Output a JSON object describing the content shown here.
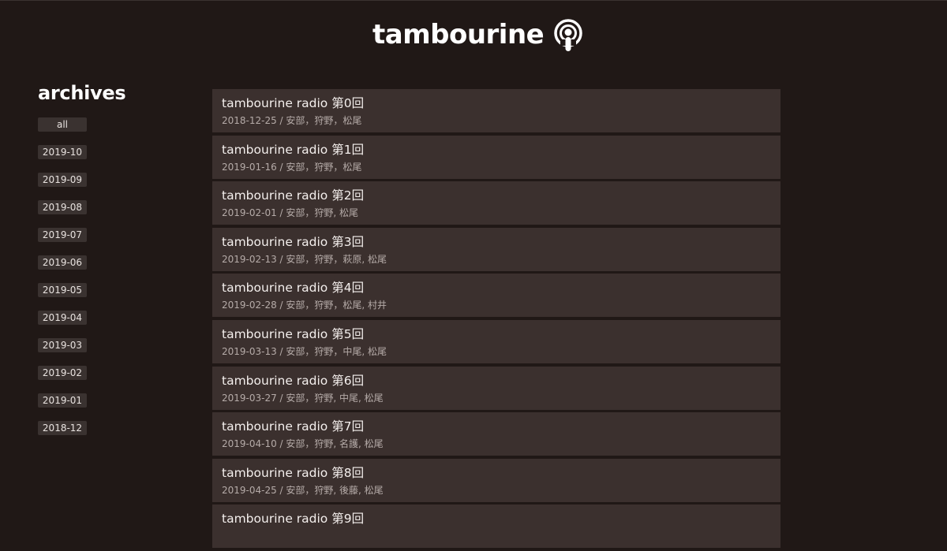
{
  "header": {
    "logo_text": "tambourine",
    "podcast_icon": "podcast-icon"
  },
  "sidebar": {
    "title": "archives",
    "items": [
      "all",
      "2019-10",
      "2019-09",
      "2019-08",
      "2019-07",
      "2019-06",
      "2019-05",
      "2019-04",
      "2019-03",
      "2019-02",
      "2019-01",
      "2018-12"
    ]
  },
  "episodes": [
    {
      "title": "tambourine radio 第0回",
      "meta": "2018-12-25 / 安部，狩野，松尾"
    },
    {
      "title": "tambourine radio 第1回",
      "meta": "2019-01-16 / 安部，狩野，松尾"
    },
    {
      "title": "tambourine radio 第2回",
      "meta": "2019-02-01 / 安部，狩野, 松尾"
    },
    {
      "title": "tambourine radio 第3回",
      "meta": "2019-02-13 / 安部，狩野，萩原, 松尾"
    },
    {
      "title": "tambourine radio 第4回",
      "meta": "2019-02-28 / 安部，狩野，松尾, 村井"
    },
    {
      "title": "tambourine radio 第5回",
      "meta": "2019-03-13 / 安部，狩野，中尾, 松尾"
    },
    {
      "title": "tambourine radio 第6回",
      "meta": "2019-03-27 / 安部，狩野, 中尾, 松尾"
    },
    {
      "title": "tambourine radio 第7回",
      "meta": "2019-04-10 / 安部，狩野, 名護, 松尾"
    },
    {
      "title": "tambourine radio 第8回",
      "meta": "2019-04-25 / 安部，狩野, 後藤, 松尾"
    },
    {
      "title": "tambourine radio 第9回",
      "meta": ""
    }
  ]
}
